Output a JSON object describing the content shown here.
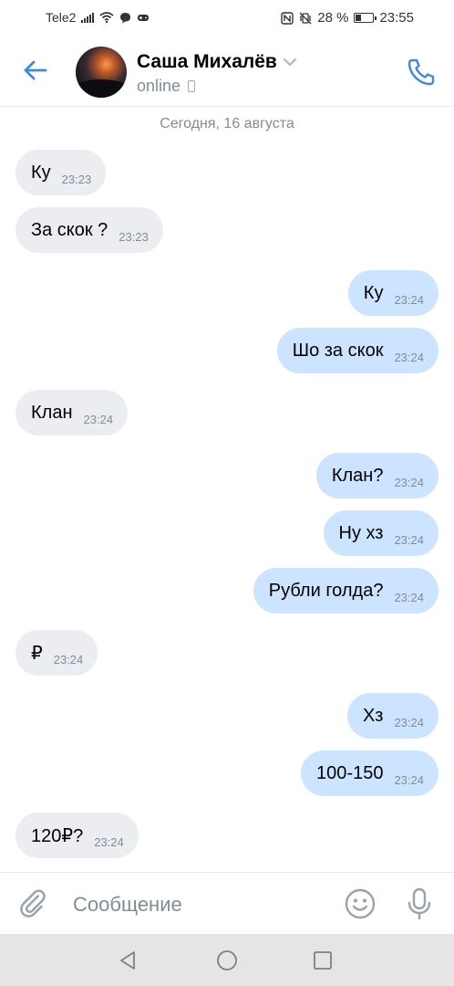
{
  "status_bar": {
    "carrier": "Tele2",
    "battery": "28 %",
    "time": "23:55"
  },
  "header": {
    "name": "Саша Михалёв",
    "status": "online",
    "icons": [
      "back-arrow-icon",
      "chevron-down-icon",
      "mobile-device-icon",
      "phone-call-icon"
    ]
  },
  "chat": {
    "date_separator": "Сегодня, 16 августа",
    "messages": [
      {
        "dir": "in",
        "text": "Ку",
        "time": "23:23"
      },
      {
        "dir": "in",
        "text": "За скок ?",
        "time": "23:23"
      },
      {
        "dir": "out",
        "text": "Ку",
        "time": "23:24"
      },
      {
        "dir": "out",
        "text": "Шо за скок",
        "time": "23:24"
      },
      {
        "dir": "in",
        "text": "Клан",
        "time": "23:24"
      },
      {
        "dir": "out",
        "text": "Клан?",
        "time": "23:24"
      },
      {
        "dir": "out",
        "text": "Ну хз",
        "time": "23:24"
      },
      {
        "dir": "out",
        "text": "Рубли голда?",
        "time": "23:24"
      },
      {
        "dir": "in",
        "text": "₽",
        "time": "23:24"
      },
      {
        "dir": "out",
        "text": "Хз",
        "time": "23:24"
      },
      {
        "dir": "out",
        "text": "100-150",
        "time": "23:24"
      },
      {
        "dir": "in",
        "text": "120₽?",
        "time": "23:24"
      }
    ]
  },
  "composer": {
    "placeholder": "Сообщение",
    "value": "",
    "icons": [
      "paperclip-icon",
      "smiley-icon",
      "microphone-icon"
    ]
  },
  "colors": {
    "accent": "#3f8ae0",
    "incoming_bubble": "#ebedf0",
    "outgoing_bubble": "#cce4ff",
    "secondary_text": "#818c99"
  }
}
